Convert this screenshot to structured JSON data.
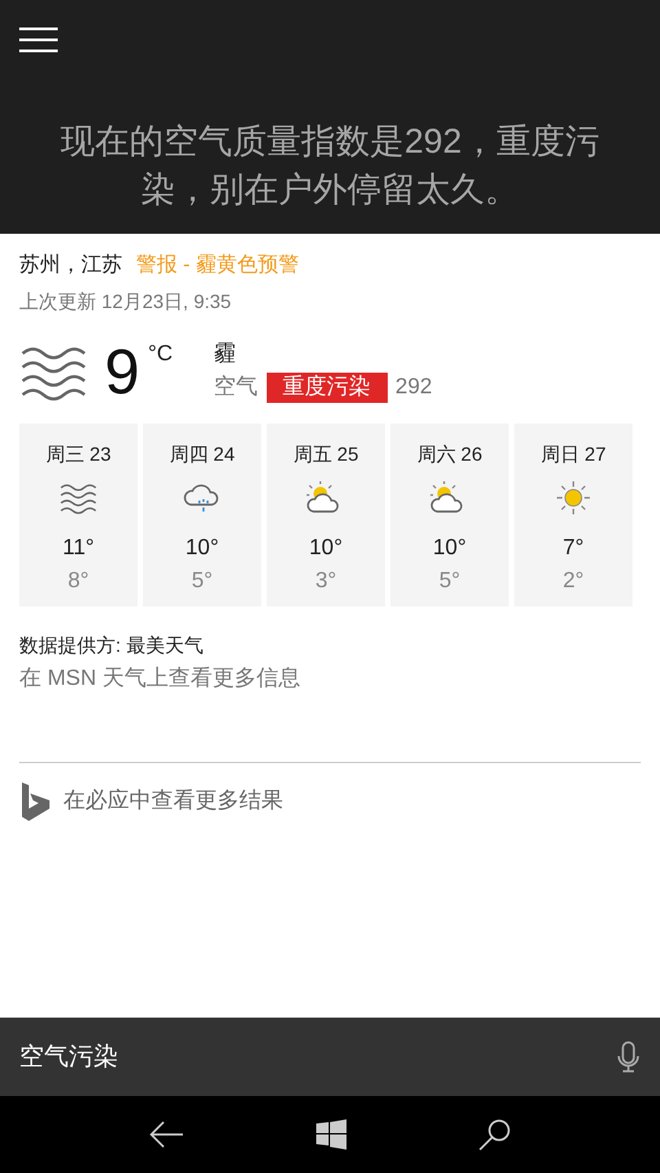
{
  "headline": "现在的空气质量指数是292，重度污染，别在户外停留太久。",
  "location": "苏州，江苏",
  "alert": "警报 - 霾黄色预警",
  "updated": "上次更新 12月23日, 9:35",
  "current": {
    "kind": "haze",
    "temp": "9",
    "unit": "°C",
    "condition": "霾",
    "air_label": "空气",
    "air_badge": "重度污染",
    "aqi": "292"
  },
  "forecast": [
    {
      "day": "周三 23",
      "kind": "haze",
      "high": "11°",
      "low": "8°"
    },
    {
      "day": "周四 24",
      "kind": "rain",
      "high": "10°",
      "low": "5°"
    },
    {
      "day": "周五 25",
      "kind": "partly",
      "high": "10°",
      "low": "3°"
    },
    {
      "day": "周六 26",
      "kind": "partly",
      "high": "10°",
      "low": "5°"
    },
    {
      "day": "周日 27",
      "kind": "sunny",
      "high": "7°",
      "low": "2°"
    }
  ],
  "provider": "数据提供方: 最美天气",
  "msn_link": "在 MSN 天气上查看更多信息",
  "bing_link": "在必应中查看更多结果",
  "search": {
    "value": "空气污染"
  }
}
